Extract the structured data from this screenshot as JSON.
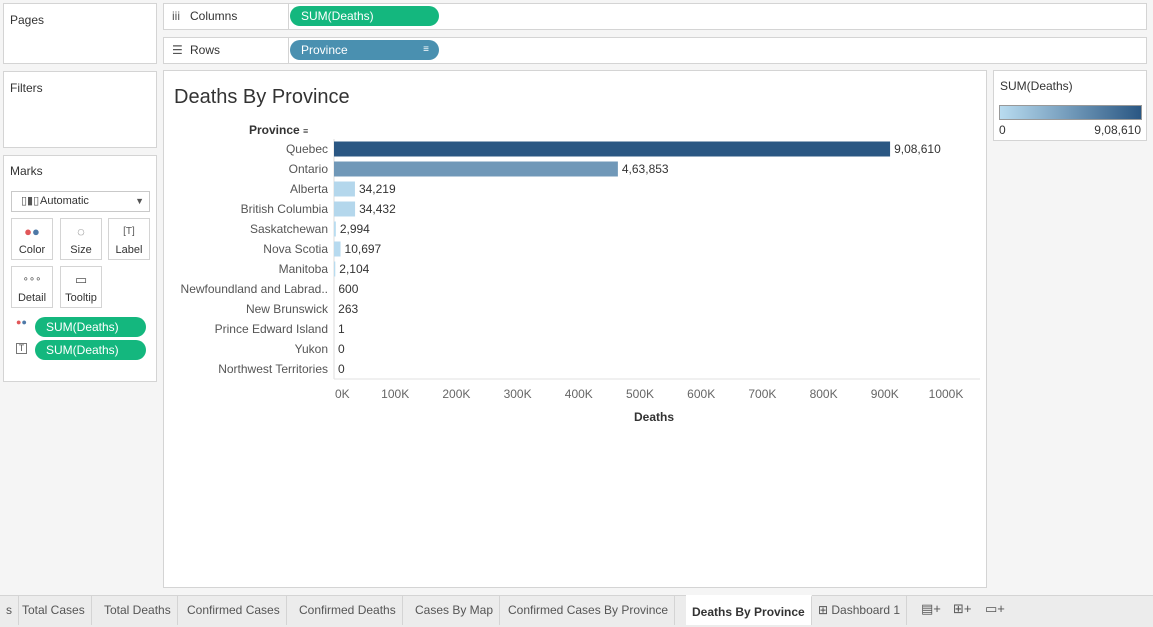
{
  "panels": {
    "pages": "Pages",
    "filters": "Filters",
    "marks": "Marks"
  },
  "shelves": {
    "columns_label": "Columns",
    "columns_pill": "SUM(Deaths)",
    "rows_label": "Rows",
    "rows_pill": "Province"
  },
  "marks": {
    "mark_type": "Automatic",
    "buttons": [
      "Color",
      "Size",
      "Label",
      "Detail",
      "Tooltip"
    ],
    "pills": [
      "SUM(Deaths)",
      "SUM(Deaths)"
    ]
  },
  "legend": {
    "title": "SUM(Deaths)",
    "min_label": "0",
    "max_label": "9,08,610",
    "color_low": "#b9dcf0",
    "color_high": "#2a5783"
  },
  "chart_data": {
    "type": "bar",
    "title": "Deaths By Province",
    "row_header": "Province",
    "xlabel": "Deaths",
    "xlim": [
      0,
      1000000
    ],
    "x_ticks": [
      "0K",
      "100K",
      "200K",
      "300K",
      "400K",
      "500K",
      "600K",
      "700K",
      "800K",
      "900K",
      "1000K"
    ],
    "categories": [
      "Quebec",
      "Ontario",
      "Alberta",
      "British Columbia",
      "Saskatchewan",
      "Nova Scotia",
      "Manitoba",
      "Newfoundland and Labrad..",
      "New Brunswick",
      "Prince Edward Island",
      "Yukon",
      "Northwest Territories"
    ],
    "values": [
      908610,
      463853,
      34219,
      34432,
      2994,
      10697,
      2104,
      600,
      263,
      1,
      0,
      0
    ],
    "value_labels": [
      "9,08,610",
      "4,63,853",
      "34,219",
      "34,432",
      "2,994",
      "10,697",
      "2,104",
      "600",
      "263",
      "1",
      "0",
      "0"
    ]
  },
  "tabs": [
    "s",
    "Total Cases",
    "Total Deaths",
    "Confirmed Cases",
    "Confirmed Deaths",
    "Cases By Map",
    "Confirmed Cases By Province",
    "Deaths By Province",
    "Dashboard 1"
  ],
  "active_tab": "Deaths By Province"
}
